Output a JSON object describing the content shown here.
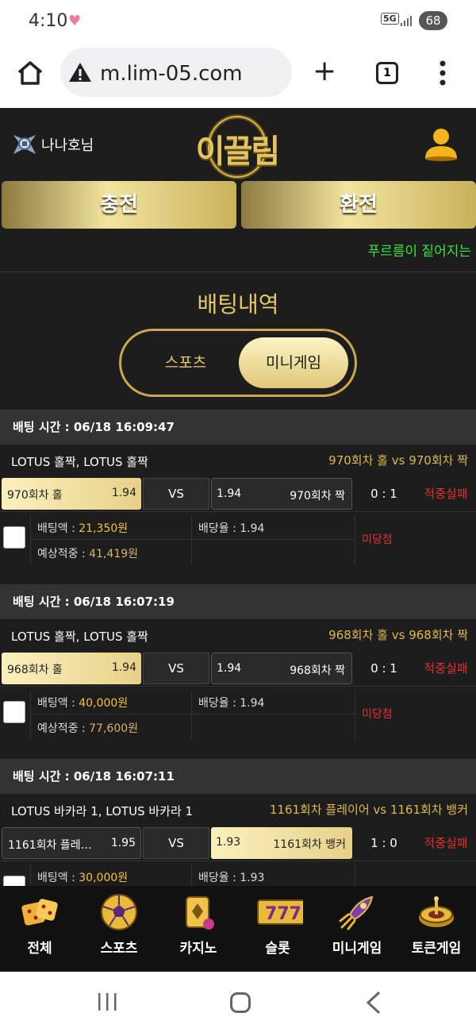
{
  "status_bar": {
    "time": "4:10",
    "network": "5G",
    "battery": "68"
  },
  "browser": {
    "url": "m.lim-05.com",
    "tab_count": "1"
  },
  "header": {
    "username": "나나호님",
    "logo_text": "이끌림"
  },
  "actions": {
    "charge": "충전",
    "exchange": "환전"
  },
  "marquee": "푸르름이 짙어지는",
  "section": {
    "title": "배팅내역",
    "tab_sports": "스포츠",
    "tab_mini": "미니게임",
    "active_tab": "미니게임"
  },
  "bets": [
    {
      "time": "배팅 시간 : 06/18 16:09:47",
      "game": "LOTUS 홀짝, LOTUS 홀짝",
      "match": "970회차 홀  vs  970회차 짝",
      "home_label": "970회차 홀",
      "home_odds": "1.94",
      "vs": "VS",
      "away_odds": "1.94",
      "away_label": "970회차 짝",
      "selected": "home",
      "score": "0 : 1",
      "result": "적중실패",
      "bet_amount_label": "배팅액 : ",
      "bet_amount": "21,350원",
      "expected_label": "예상적중 : ",
      "expected": "41,419원",
      "rate_label": "배당율 : ",
      "rate": "1.94",
      "status": "미당첨"
    },
    {
      "time": "배팅 시간 : 06/18 16:07:19",
      "game": "LOTUS 홀짝, LOTUS 홀짝",
      "match": "968회차 홀  vs  968회차 짝",
      "home_label": "968회차 홀",
      "home_odds": "1.94",
      "vs": "VS",
      "away_odds": "1.94",
      "away_label": "968회차 짝",
      "selected": "home",
      "score": "0 : 1",
      "result": "적중실패",
      "bet_amount_label": "배팅액 : ",
      "bet_amount": "40,000원",
      "expected_label": "예상적중 : ",
      "expected": "77,600원",
      "rate_label": "배당율 : ",
      "rate": "1.94",
      "status": "미당첨"
    },
    {
      "time": "배팅 시간 : 06/18 16:07:11",
      "game": "LOTUS 바카라 1, LOTUS 바카라 1",
      "match": "1161회차 플레이어  vs  1161회차 뱅커",
      "home_label": "1161회차 플레…",
      "home_odds": "1.95",
      "vs": "VS",
      "away_odds": "1.93",
      "away_label": "1161회차 뱅커",
      "selected": "away",
      "score": "1 : 0",
      "result": "적중실패",
      "bet_amount_label": "배팅액 : ",
      "bet_amount": "30,000원",
      "expected_label": "",
      "expected": "",
      "rate_label": "배당율 : ",
      "rate": "1.93",
      "status": ""
    }
  ],
  "bottom_nav": [
    {
      "label": "전체",
      "icon": "dice-icon"
    },
    {
      "label": "스포츠",
      "icon": "soccer-ball-icon"
    },
    {
      "label": "카지노",
      "icon": "cards-icon"
    },
    {
      "label": "슬롯",
      "icon": "slot-777-icon"
    },
    {
      "label": "미니게임",
      "icon": "rocket-icon"
    },
    {
      "label": "토큰게임",
      "icon": "roulette-icon"
    }
  ],
  "slot_text": "777",
  "colors": {
    "gold": "#e6c96a",
    "green": "#3fe23f",
    "red": "#e53030",
    "bg": "#1d1d1d"
  }
}
